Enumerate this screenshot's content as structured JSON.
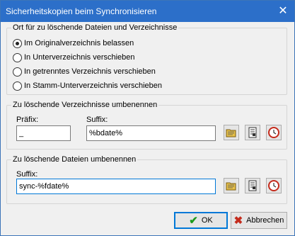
{
  "window": {
    "title": "Sicherheitskopien beim Synchronisieren",
    "close_symbol": "✕"
  },
  "location_group": {
    "legend": "Ort für zu löschende Dateien und Verzeichnisse",
    "options": [
      {
        "label": "Im Originalverzeichnis belassen",
        "checked": true
      },
      {
        "label": "In Unterverzeichnis verschieben",
        "checked": false
      },
      {
        "label": "In getrenntes Verzeichnis verschieben",
        "checked": false
      },
      {
        "label": "In Stamm-Unterverzeichnis verschieben",
        "checked": false
      }
    ]
  },
  "dir_group": {
    "legend": "Zu löschende Verzeichnisse umbenennen",
    "prefix_label": "Präfix:",
    "prefix_value": "_",
    "suffix_label": "Suffix:",
    "suffix_value": "%bdate%"
  },
  "file_group": {
    "legend": "Zu löschende Dateien umbenennen",
    "suffix_label": "Suffix:",
    "suffix_value": "sync-%fdate%"
  },
  "buttons": {
    "ok": "OK",
    "cancel": "Abbrechen"
  },
  "colors": {
    "titlebar": "#2c6fc9",
    "ok_check": "#1c9a1c",
    "cancel_x": "#c42b1c"
  },
  "icons": [
    "folder-icon",
    "document-icon",
    "clock-icon",
    "check-icon",
    "cancel-x-icon",
    "close-icon"
  ]
}
